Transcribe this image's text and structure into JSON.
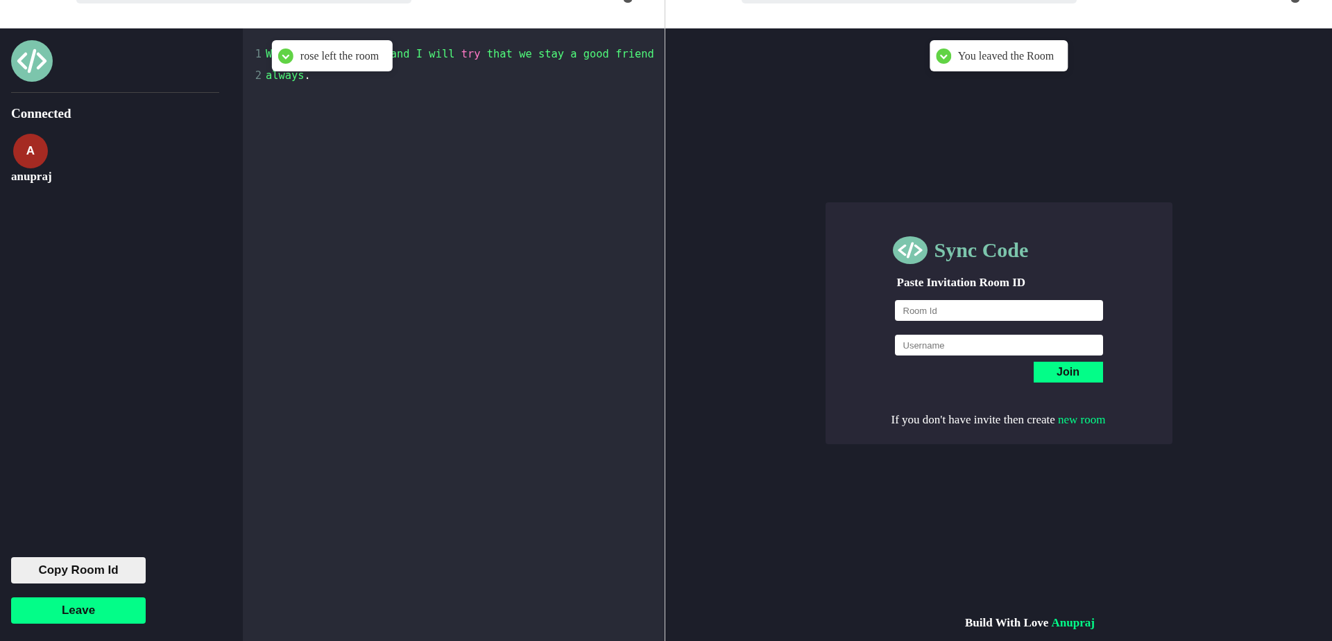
{
  "left_window": {
    "toast": {
      "message": "rose left the room"
    },
    "sidebar": {
      "section_title": "Connected",
      "clients": [
        {
          "initial": "A",
          "name": "anupraj"
        }
      ],
      "buttons": [
        {
          "label": "Copy Room Id",
          "kind": "secondary"
        },
        {
          "label": "Leave",
          "kind": "primary"
        }
      ]
    },
    "editor": {
      "lines": [
        {
          "number": "1",
          "tokens": [
            {
              "text": "W",
              "kind": "text"
            },
            {
              "text": "and I will",
              "kind": "text",
              "hidden_before": true
            },
            {
              "text": "try",
              "kind": "keyword"
            },
            {
              "text": "that we stay a good friend",
              "kind": "text"
            }
          ]
        },
        {
          "number": "2",
          "tokens": [
            {
              "text": "always",
              "kind": "text"
            },
            {
              "text": ".",
              "kind": "punct"
            }
          ]
        }
      ]
    }
  },
  "right_window": {
    "toast": {
      "message": "You leaved the Room"
    },
    "join_card": {
      "title": "Sync Code",
      "subtitle": "Paste Invitation Room ID",
      "fields": [
        {
          "placeholder": "Room Id"
        },
        {
          "placeholder": "Username"
        }
      ],
      "join_button": "Join",
      "hint": "If you don't have invite then create ",
      "hint_link": "new room"
    },
    "footer": {
      "text": "Build With Love ",
      "author": "Anupraj"
    }
  }
}
